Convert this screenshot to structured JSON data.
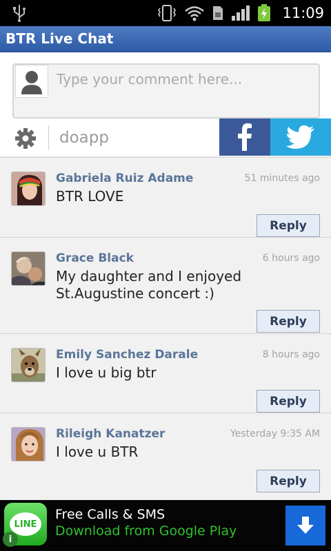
{
  "status_bar": {
    "time": "11:09"
  },
  "app": {
    "title": "BTR Live Chat"
  },
  "composer": {
    "placeholder": "Type your comment here...",
    "brand": "doapp"
  },
  "comments": [
    {
      "name": "Gabriela Ruiz Adame",
      "time": "51 minutes ago",
      "message": "BTR LOVE",
      "reply_label": "Reply"
    },
    {
      "name": "Grace Black",
      "time": "6 hours ago",
      "message": "My daughter and I enjoyed St.Augustine concert :)",
      "reply_label": "Reply"
    },
    {
      "name": "Emily Sanchez Darale",
      "time": "8 hours ago",
      "message": "I love u big btr",
      "reply_label": "Reply"
    },
    {
      "name": "Rileigh Kanatzer",
      "time": "Yesterday 9:35 AM",
      "message": "I love u BTR",
      "reply_label": "Reply"
    }
  ],
  "ad": {
    "logo_text": "LINE",
    "title": "Free Calls & SMS",
    "subtitle": "Download from Google Play"
  },
  "colors": {
    "title_bar": "#3d69b5",
    "facebook": "#3b5998",
    "twitter": "#2aa9e0",
    "name": "#5b7599"
  }
}
